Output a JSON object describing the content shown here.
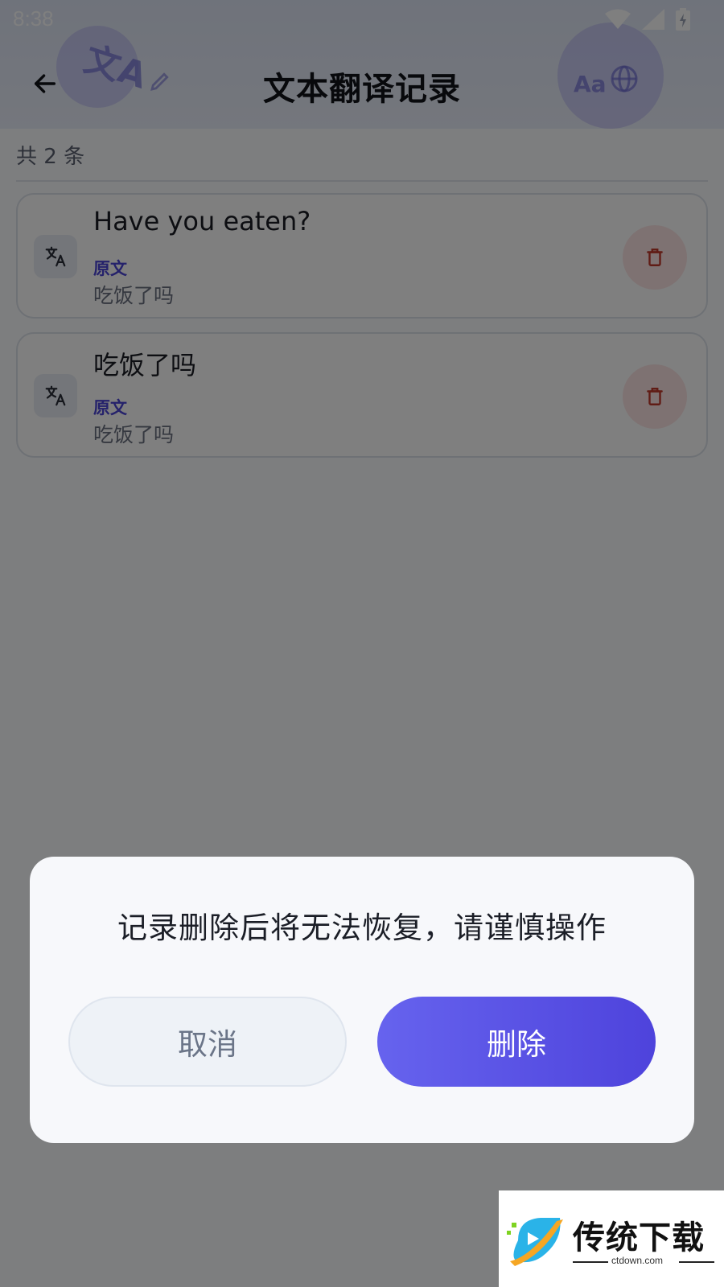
{
  "status_bar": {
    "time": "8:38"
  },
  "header": {
    "title": "文本翻译记录",
    "deco_aa": "Aa",
    "deco_wa": "文A"
  },
  "list": {
    "count_label": "共 2 条",
    "records": [
      {
        "result": "Have you eaten?",
        "source_label": "原文",
        "source_text": "吃饭了吗"
      },
      {
        "result": "吃饭了吗",
        "source_label": "原文",
        "source_text": "吃饭了吗"
      }
    ]
  },
  "dialog": {
    "message": "记录删除后将无法恢复，请谨慎操作",
    "cancel_label": "取消",
    "confirm_label": "删除"
  },
  "watermark": {
    "title": "传统下载",
    "url": "ctdown.com"
  },
  "colors": {
    "accent": "#4e43dc",
    "accent_light": "#6663ee",
    "delete_bg": "#fde5e5",
    "delete_icon": "#c0392b"
  }
}
